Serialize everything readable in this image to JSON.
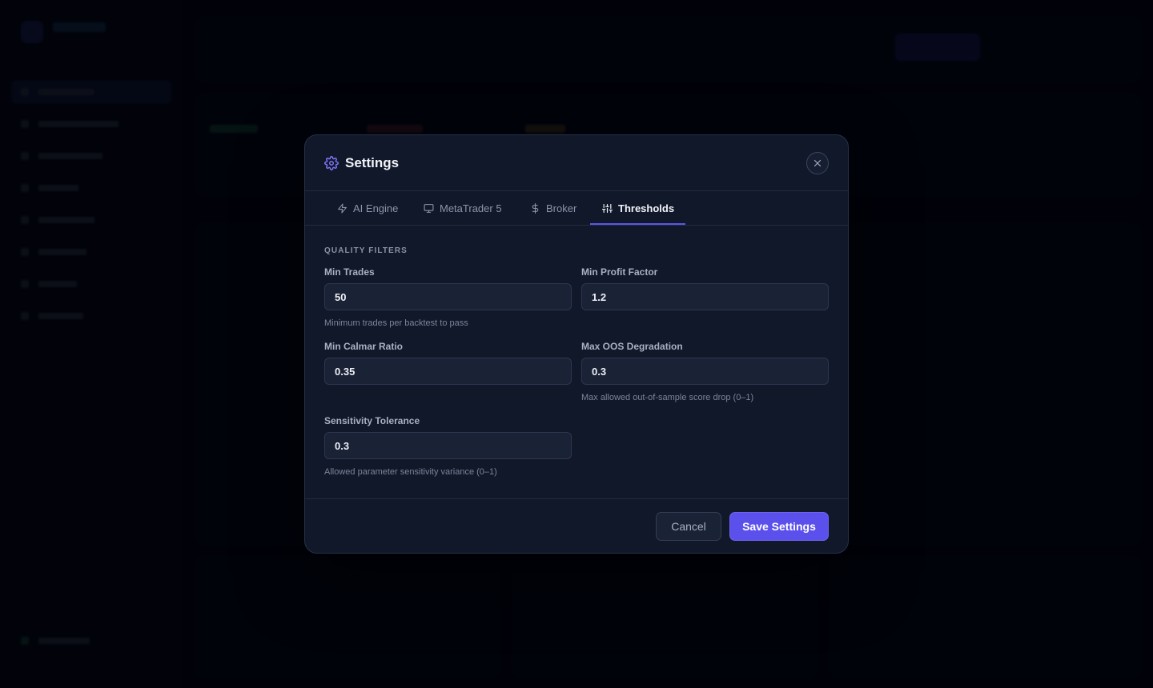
{
  "colors": {
    "accent": "#5b50ec",
    "modal_bg": "#111829",
    "page_bg": "#02030a"
  },
  "modal": {
    "title": "Settings",
    "title_icon": "gear-icon",
    "close_icon": "close-icon",
    "tabs": [
      {
        "label": "AI Engine",
        "icon": "bolt-icon",
        "active": false
      },
      {
        "label": "MetaTrader 5",
        "icon": "monitor-icon",
        "active": false
      },
      {
        "label": "Broker",
        "icon": "dollar-icon",
        "active": false
      },
      {
        "label": "Thresholds",
        "icon": "sliders-icon",
        "active": true
      }
    ],
    "section_label": "QUALITY FILTERS",
    "fields": [
      {
        "label": "Min Trades",
        "value": "50",
        "hint": "Minimum trades per backtest to pass"
      },
      {
        "label": "Min Profit Factor",
        "value": "1.2",
        "hint": ""
      },
      {
        "label": "Min Calmar Ratio",
        "value": "0.35",
        "hint": ""
      },
      {
        "label": "Max OOS Degradation",
        "value": "0.3",
        "hint": "Max allowed out-of-sample score drop (0–1)"
      },
      {
        "label": "Sensitivity Tolerance",
        "value": "0.3",
        "hint": "Allowed parameter sensitivity variance (0–1)"
      }
    ],
    "cancel_label": "Cancel",
    "save_label": "Save Settings"
  }
}
